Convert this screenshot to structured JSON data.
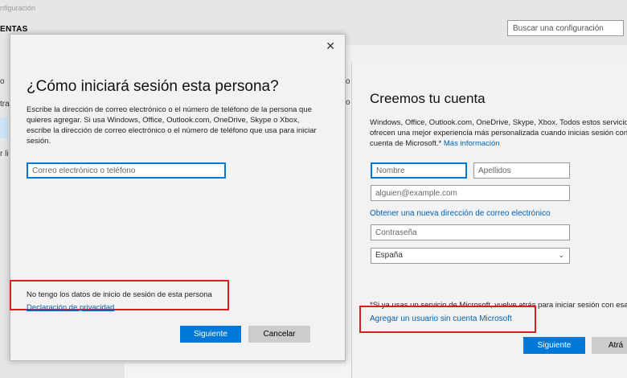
{
  "settings": {
    "title": "nfiguración",
    "heading": "ENTAS",
    "search_placeholder": "Buscar una configuración",
    "nav_fragments": [
      "o",
      "tra",
      "r li"
    ],
    "main_fragments": [
      "o",
      "o"
    ]
  },
  "left_dialog": {
    "title": "¿Cómo iniciará sesión esta persona?",
    "description": "Escribe la dirección de correo electrónico o el número de teléfono de la persona que quieres agregar. Si usa Windows, Office, Outlook.com, OneDrive, Skype o Xbox, escribe la dirección de correo electrónico o el número de teléfono que usa para iniciar sesión.",
    "email_placeholder": "Correo electrónico o teléfono",
    "no_data_link": "No tengo los datos de inicio de sesión de esta persona",
    "privacy_link": "Declaración de privacidad",
    "next_button": "Siguiente",
    "cancel_button": "Cancelar"
  },
  "right_dialog": {
    "title": "Creemos tu cuenta",
    "text_line1": "Windows, Office, Outlook.com, OneDrive, Skype, Xbox. Todos estos servicios",
    "text_line2": "ofrecen una mejor experiencia más personalizada cuando inicias sesión con",
    "text_line3": "cuenta de Microsoft.*",
    "more_info_link": "Más información",
    "first_name_placeholder": "Nombre",
    "last_name_placeholder": "Apellidos",
    "email_placeholder": "alguien@example.com",
    "new_email_link": "Obtener una nueva dirección de correo electrónico",
    "password_placeholder": "Contraseña",
    "country_value": "España",
    "note": "*Si ya usas un servicio de Microsoft, vuelve atrás para iniciar sesión con esa c",
    "add_without_account_link": "Agregar un usuario sin cuenta Microsoft",
    "next_button": "Siguiente",
    "back_button": "Atrá"
  },
  "colors": {
    "accent": "#0078d7",
    "link": "#0063b1",
    "highlight_red": "#e11a22"
  },
  "icons": {
    "close": "close-icon",
    "search": "search-icon",
    "dropdown": "chevron-down-icon"
  }
}
